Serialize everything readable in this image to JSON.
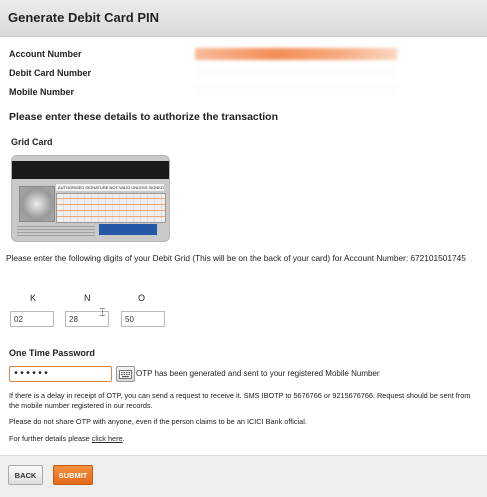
{
  "page": {
    "title": "Generate Debit Card PIN"
  },
  "account": {
    "account_number_label": "Account Number",
    "debit_card_label": "Debit Card Number",
    "mobile_label": "Mobile Number"
  },
  "authorize": {
    "heading": "Please enter these details to authorize the transaction",
    "grid_card_label": "Grid Card",
    "card_image_text": "AUTHORISED SIGNATURE NOT VALID UNLESS SIGNED",
    "instruction": "Please enter the following digits of your Debit Grid (This will be on the back of your card) for Account Number: 672101501745",
    "columns": [
      {
        "label": "K",
        "value": "02"
      },
      {
        "label": "N",
        "value": "28"
      },
      {
        "label": "O",
        "value": "50"
      }
    ]
  },
  "otp": {
    "heading": "One Time Password",
    "value": "••••••",
    "message": "OTP has been generated and sent to your registered Mobile Number",
    "icon": "keyboard-icon"
  },
  "notes": {
    "delay": "If there is a delay in receipt of OTP, you can send a request to receive it. SMS IBOTP to 5676766 or 9215676766. Request should be sent from the mobile number registered in our records.",
    "warning": "Please do not share OTP with anyone, even if the person claims to be an ICICI Bank official.",
    "details_prefix": "For further details please ",
    "details_link": "click here",
    "details_suffix": "."
  },
  "actions": {
    "back_label": "BACK",
    "submit_label": "SUBMIT"
  },
  "colors": {
    "accent": "#e67323",
    "otp_border": "#e0843f"
  }
}
